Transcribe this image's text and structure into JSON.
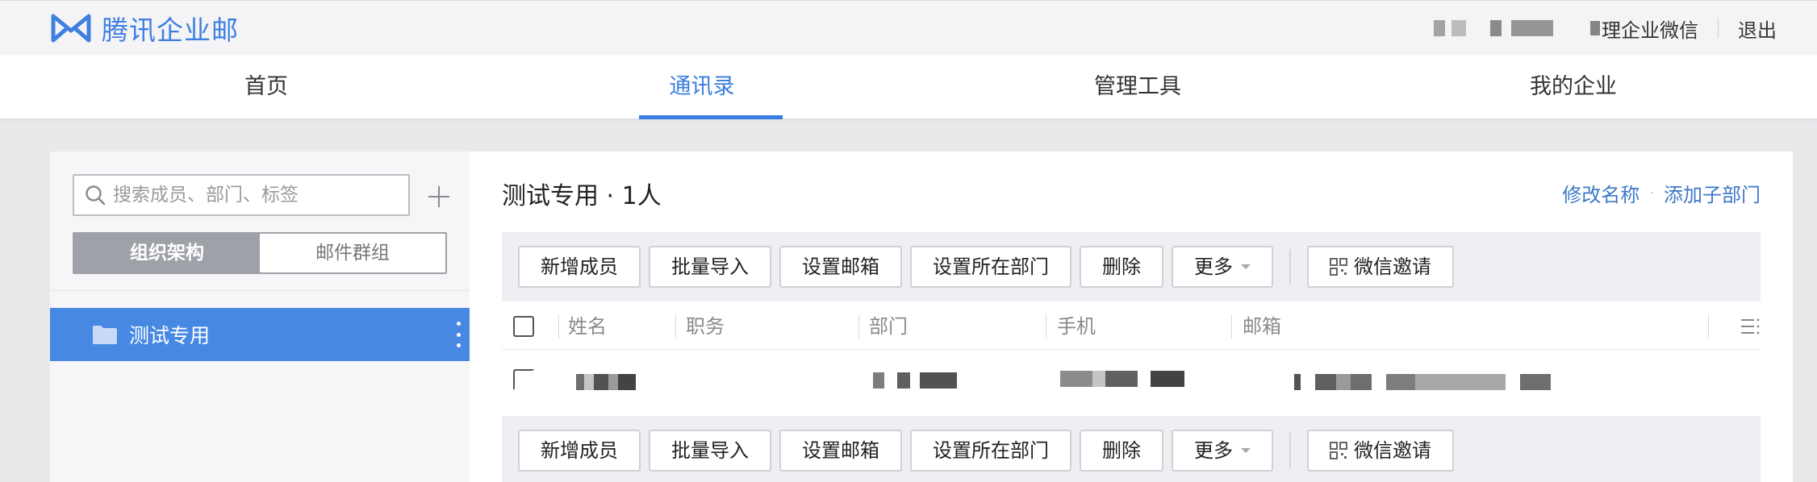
{
  "app": {
    "brand": "腾讯企业邮",
    "brand_color": "#3f7fe0",
    "logo_icon": "tencent-exmail-logo-icon"
  },
  "topbar": {
    "manage_wechat": "理企业微信",
    "logout": "退出"
  },
  "nav": {
    "tabs": [
      {
        "label": "首页"
      },
      {
        "label": "通讯录",
        "active": true
      },
      {
        "label": "管理工具"
      },
      {
        "label": "我的企业"
      }
    ],
    "accent_color": "#3a7de0"
  },
  "sidebar": {
    "search_placeholder": "搜索成员、部门、标签",
    "add_icon": "plus-icon",
    "segments": {
      "org": "组织架构",
      "mail_group": "邮件群组",
      "selected": "org"
    },
    "departments": [
      {
        "name": "测试专用",
        "selected": true,
        "icon": "folder-icon"
      }
    ]
  },
  "main": {
    "title": "测试专用 · 1人",
    "actions": {
      "rename": "修改名称",
      "add_sub": "添加子部门"
    },
    "toolbar": {
      "add_member": "新增成员",
      "batch_import": "批量导入",
      "set_mailbox": "设置邮箱",
      "set_department": "设置所在部门",
      "delete": "删除",
      "more": "更多",
      "wechat_invite": "微信邀请"
    },
    "table": {
      "columns": [
        "姓名",
        "职务",
        "部门",
        "手机",
        "邮箱"
      ],
      "rows": [
        {
          "name": "",
          "title": "",
          "department": "",
          "phone": "",
          "email": ""
        }
      ]
    }
  }
}
